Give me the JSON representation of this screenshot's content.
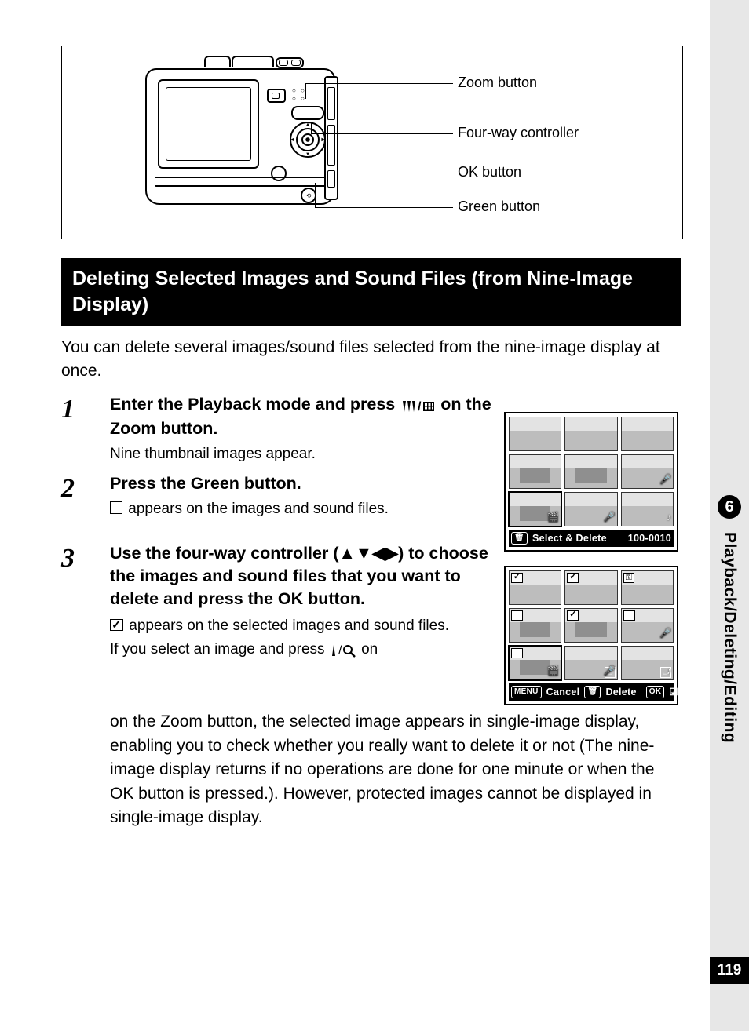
{
  "tab": {
    "chapter_number": "6",
    "chapter_title": "Playback/Deleting/Editing"
  },
  "page_number": "119",
  "diagram": {
    "labels": {
      "zoom": "Zoom button",
      "fourway": "Four-way controller",
      "ok": "OK button",
      "green": "Green button"
    }
  },
  "heading": "Deleting Selected Images and Sound Files (from Nine-Image Display)",
  "intro": "You can delete several images/sound files selected from the nine-image display at once.",
  "steps": {
    "s1": {
      "title_a": "Enter the Playback mode and press ",
      "title_b": " on the Zoom button.",
      "sub": "Nine thumbnail images appear."
    },
    "s2": {
      "title": "Press the Green button.",
      "sub": " appears on the images and sound files."
    },
    "s3": {
      "title": "Use the four-way controller (▲▼◀▶) to choose the images and sound files that you want to delete and press the OK button.",
      "sub_a": " appears on the selected images and sound files.",
      "sub_b": "If you select an image and press ",
      "sub_c": " on the Zoom button, the selected image appears in single-image display, enabling you to check whether you really want to delete it or not (The nine-image display returns if no operations are done for one minute or when the OK button is pressed.). However, protected images cannot be displayed in single-image display."
    }
  },
  "lcd1": {
    "bar_label": "Select & Delete",
    "bar_right": "100-0010"
  },
  "lcd2": {
    "bar_menu": "MENU",
    "bar_cancel": "Cancel",
    "bar_delete": "Delete",
    "bar_ok": "OK"
  }
}
